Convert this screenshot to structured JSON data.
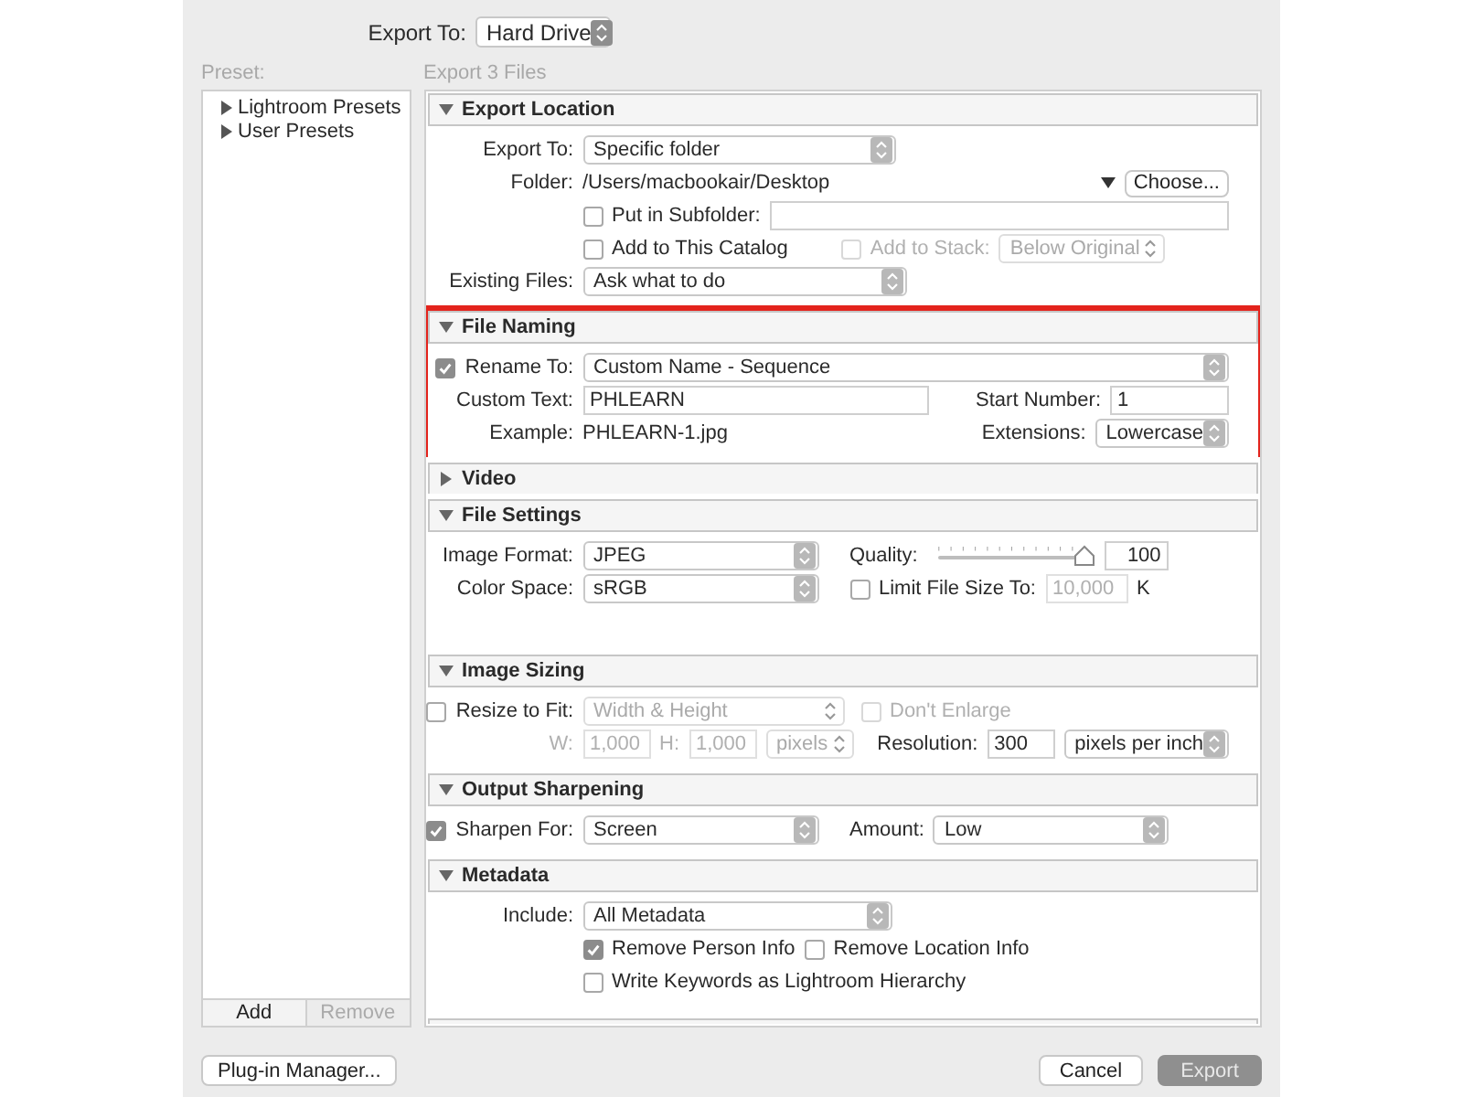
{
  "export_to": {
    "label": "Export To:",
    "value": "Hard Drive"
  },
  "preset": {
    "label": "Preset:",
    "items": [
      {
        "label": "Lightroom Presets",
        "expanded": false
      },
      {
        "label": "User Presets",
        "expanded": false
      }
    ],
    "buttons": [
      {
        "label": "Add",
        "disabled": false
      },
      {
        "label": "Remove",
        "disabled": true
      }
    ]
  },
  "summary": "Export 3 Files",
  "sections": [
    {
      "title": "Export Location",
      "expanded": true,
      "highlighted": false,
      "rows": [
        {
          "lead": {
            "kind": "label",
            "text": "Export To:",
            "disabled": false
          },
          "items": [
            {
              "kind": "select",
              "value": "Specific folder",
              "disabled": false
            }
          ]
        },
        {
          "lead": {
            "kind": "label",
            "text": "Folder:",
            "disabled": false
          },
          "items": [
            {
              "kind": "text",
              "text": "/Users/macbookair/Desktop",
              "disabled": false
            },
            {
              "kind": "menu",
              "disabled": false
            },
            {
              "kind": "button",
              "label": "Choose...",
              "disabled": false
            }
          ]
        },
        {
          "items": [
            {
              "kind": "checkbox",
              "label": "Put in Subfolder:",
              "checked": false,
              "disabled": false
            },
            {
              "kind": "field",
              "disabled": false
            }
          ]
        },
        {
          "items": [
            {
              "kind": "checkbox",
              "label": "Add to This Catalog",
              "checked": false,
              "disabled": false
            },
            {
              "kind": "checkbox",
              "label": "Add to Stack:",
              "checked": false,
              "disabled": true
            },
            {
              "kind": "select",
              "value": "Below Original",
              "disabled": true
            }
          ]
        },
        {
          "lead": {
            "kind": "label",
            "text": "Existing Files:",
            "disabled": false
          },
          "items": [
            {
              "kind": "select",
              "value": "Ask what to do",
              "disabled": false
            }
          ]
        }
      ]
    },
    {
      "title": "File Naming",
      "expanded": true,
      "highlighted": true,
      "rows": [
        {
          "lead": {
            "kind": "checkbox",
            "text": "Rename To:",
            "checked": true,
            "disabled": false
          },
          "items": [
            {
              "kind": "select",
              "value": "Custom Name - Sequence",
              "disabled": false
            }
          ]
        },
        {
          "lead": {
            "kind": "label",
            "text": "Custom Text:",
            "disabled": false
          },
          "items": [
            {
              "kind": "field",
              "value": "PHLEARN",
              "disabled": false
            },
            {
              "kind": "label",
              "text": "Start Number:",
              "disabled": false
            },
            {
              "kind": "field",
              "value": "1",
              "disabled": false
            }
          ]
        },
        {
          "lead": {
            "kind": "label",
            "text": "Example:",
            "disabled": false
          },
          "items": [
            {
              "kind": "text",
              "text": "PHLEARN-1.jpg",
              "disabled": false
            },
            {
              "kind": "label",
              "text": "Extensions:",
              "disabled": false
            },
            {
              "kind": "select",
              "value": "Lowercase",
              "disabled": false
            }
          ]
        }
      ]
    },
    {
      "title": "Video",
      "expanded": false,
      "highlighted": false
    },
    {
      "title": "File Settings",
      "expanded": true,
      "highlighted": false,
      "rows": [
        {
          "lead": {
            "kind": "label",
            "text": "Image Format:",
            "disabled": false
          },
          "items": [
            {
              "kind": "select",
              "value": "JPEG",
              "disabled": false
            },
            {
              "kind": "label",
              "text": "Quality:",
              "disabled": false
            },
            {
              "kind": "slider",
              "level": 1.0,
              "disabled": false
            },
            {
              "kind": "field",
              "value": "100",
              "disabled": false
            }
          ]
        },
        {
          "lead": {
            "kind": "label",
            "text": "Color Space:",
            "disabled": false
          },
          "items": [
            {
              "kind": "select",
              "value": "sRGB",
              "disabled": false
            },
            {
              "kind": "checkbox",
              "label": "Limit File Size To:",
              "checked": false,
              "disabled": false
            },
            {
              "kind": "field",
              "value": "10,000",
              "disabled": true
            },
            {
              "kind": "text",
              "text": "K",
              "disabled": false
            }
          ]
        }
      ]
    },
    {
      "title": "Image Sizing",
      "expanded": true,
      "highlighted": false,
      "rows": [
        {
          "lead": {
            "kind": "checkbox",
            "text": "Resize to Fit:",
            "checked": false,
            "disabled": false
          },
          "items": [
            {
              "kind": "select",
              "value": "Width & Height",
              "disabled": true
            },
            {
              "kind": "checkbox",
              "label": "Don't Enlarge",
              "checked": false,
              "disabled": true
            }
          ]
        },
        {
          "lead": {
            "kind": "label",
            "text": "W:",
            "disabled": true
          },
          "items": [
            {
              "kind": "field",
              "value": "1,000",
              "disabled": true
            },
            {
              "kind": "label",
              "text": "H:",
              "disabled": true
            },
            {
              "kind": "field",
              "value": "1,000",
              "disabled": true
            },
            {
              "kind": "select",
              "value": "pixels",
              "disabled": true
            },
            {
              "kind": "label",
              "text": "Resolution:",
              "disabled": false
            },
            {
              "kind": "field",
              "value": "300",
              "disabled": false
            },
            {
              "kind": "select",
              "value": "pixels per inch",
              "disabled": false
            }
          ]
        }
      ]
    },
    {
      "title": "Output Sharpening",
      "expanded": true,
      "highlighted": false,
      "rows": [
        {
          "lead": {
            "kind": "checkbox",
            "text": "Sharpen For:",
            "checked": true,
            "disabled": false
          },
          "items": [
            {
              "kind": "select",
              "value": "Screen",
              "disabled": false
            },
            {
              "kind": "label",
              "text": "Amount:",
              "disabled": false
            },
            {
              "kind": "select",
              "value": "Low",
              "disabled": false
            }
          ]
        }
      ]
    },
    {
      "title": "Metadata",
      "expanded": true,
      "highlighted": false,
      "rows": [
        {
          "lead": {
            "kind": "label",
            "text": "Include:",
            "disabled": false
          },
          "items": [
            {
              "kind": "select",
              "value": "All Metadata",
              "disabled": false
            }
          ]
        },
        {
          "items": [
            {
              "kind": "checkbox",
              "label": "Remove Person Info",
              "checked": true,
              "disabled": false
            },
            {
              "kind": "checkbox",
              "label": "Remove Location Info",
              "checked": false,
              "disabled": false
            }
          ]
        },
        {
          "items": [
            {
              "kind": "checkbox",
              "label": "Write Keywords as Lightroom Hierarchy",
              "checked": false,
              "disabled": false
            }
          ]
        }
      ]
    }
  ],
  "footer": {
    "left": [
      {
        "label": "Plug-in Manager...",
        "kind": "plain"
      }
    ],
    "right": [
      {
        "label": "Cancel",
        "kind": "plain"
      },
      {
        "label": "Export",
        "kind": "default"
      }
    ]
  }
}
